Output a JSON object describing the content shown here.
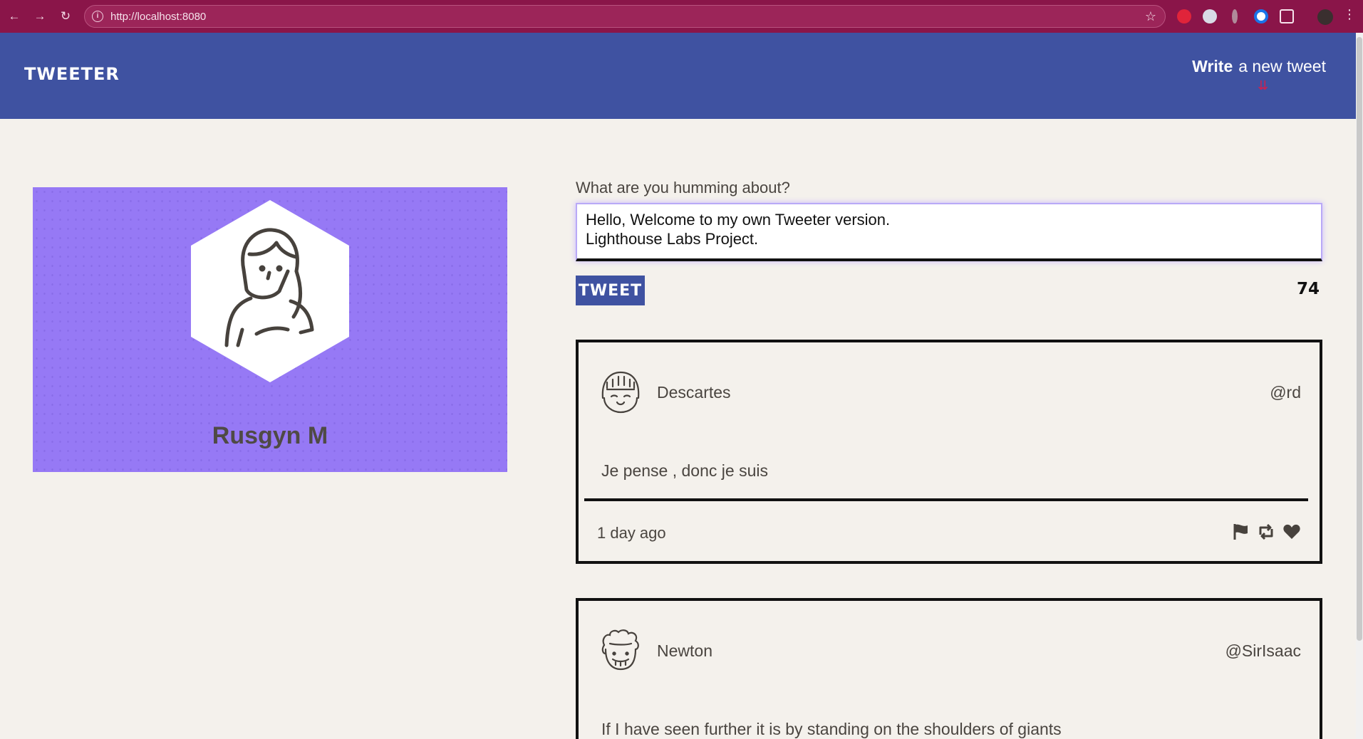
{
  "browser": {
    "url": "http://localhost:8080",
    "icons": [
      "back-arrow-icon",
      "forward-arrow-icon",
      "reload-icon",
      "site-info-icon",
      "bookmark-star-icon",
      "extensions-icon",
      "menu-icon"
    ]
  },
  "nav": {
    "brand": "TWEETER",
    "compose_bold": "Write",
    "compose_rest": "a new tweet",
    "compose_arrow": "⇊"
  },
  "profile": {
    "name": "Rusgyn M",
    "card_color": "#9679f5"
  },
  "composer": {
    "label": "What are you humming about?",
    "text": "Hello, Welcome to my own Tweeter version.\nLighthouse Labs Project.",
    "button_label": "TWEET",
    "counter": "74"
  },
  "tweets": [
    {
      "author": "Descartes",
      "handle": "@rd",
      "content": "Je pense , donc je suis",
      "time": "1 day ago",
      "actions": [
        "flag-icon",
        "retweet-icon",
        "heart-icon"
      ]
    },
    {
      "author": "Newton",
      "handle": "@SirIsaac",
      "content": "If I have seen further it is by standing on the shoulders of giants"
    }
  ],
  "colors": {
    "browser_bar": "#8a1549",
    "nav_bg": "#3f52a1",
    "page_bg": "#f4f1ec",
    "text": "#4a4540"
  }
}
